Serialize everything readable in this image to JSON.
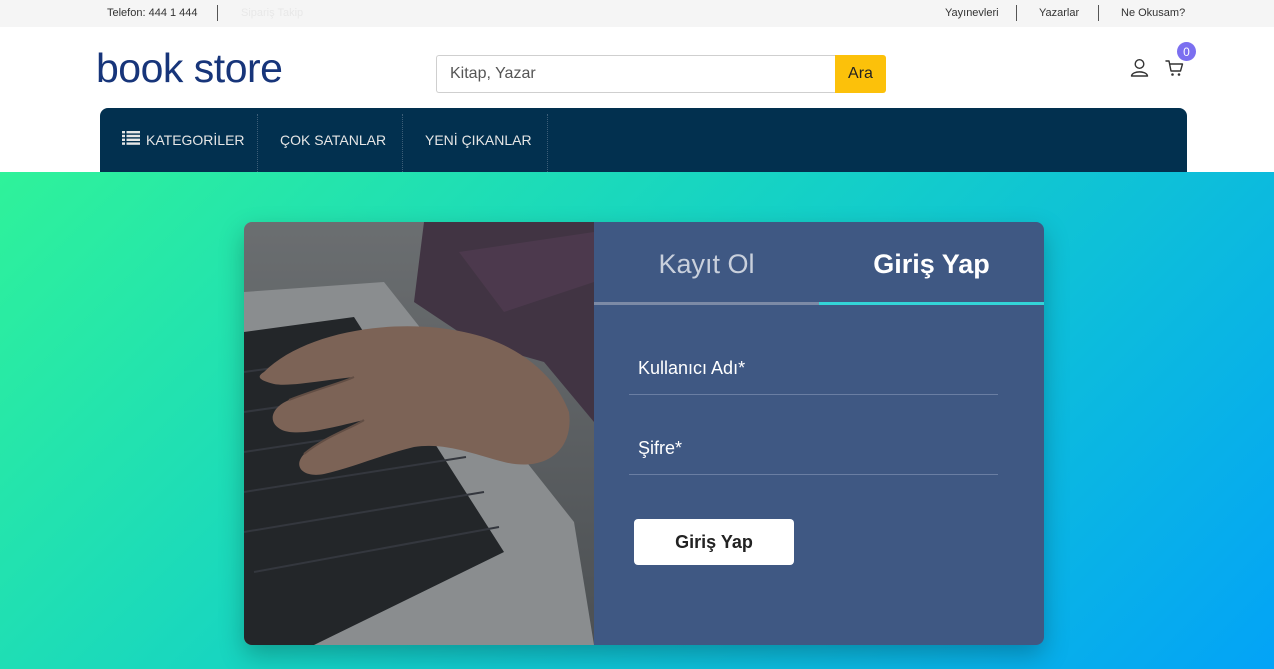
{
  "topbar": {
    "phone": "Telefon: 444 1 444",
    "order_tracking": "Sipariş Takip",
    "links": [
      "Yayınevleri",
      "Yazarlar",
      "Ne Okusam?"
    ]
  },
  "header": {
    "logo": "book store",
    "search_placeholder": "Kitap, Yazar",
    "search_button": "Ara",
    "cart_count": "0"
  },
  "nav": {
    "items": [
      "KATEGORİLER",
      "ÇOK SATANLAR",
      "YENİ ÇIKANLAR"
    ]
  },
  "login": {
    "tab_register": "Kayıt Ol",
    "tab_login": "Giriş Yap",
    "username_label": "Kullanıcı Adı*",
    "password_label": "Şifre*",
    "submit_label": "Giriş Yap"
  },
  "colors": {
    "brand": "#17357a",
    "accent_yellow": "#fcc10a",
    "nav_bg": "#02304f",
    "panel_bg": "#3f5883",
    "active_tab_line": "#33d4d8",
    "badge": "#7b6ff0"
  }
}
